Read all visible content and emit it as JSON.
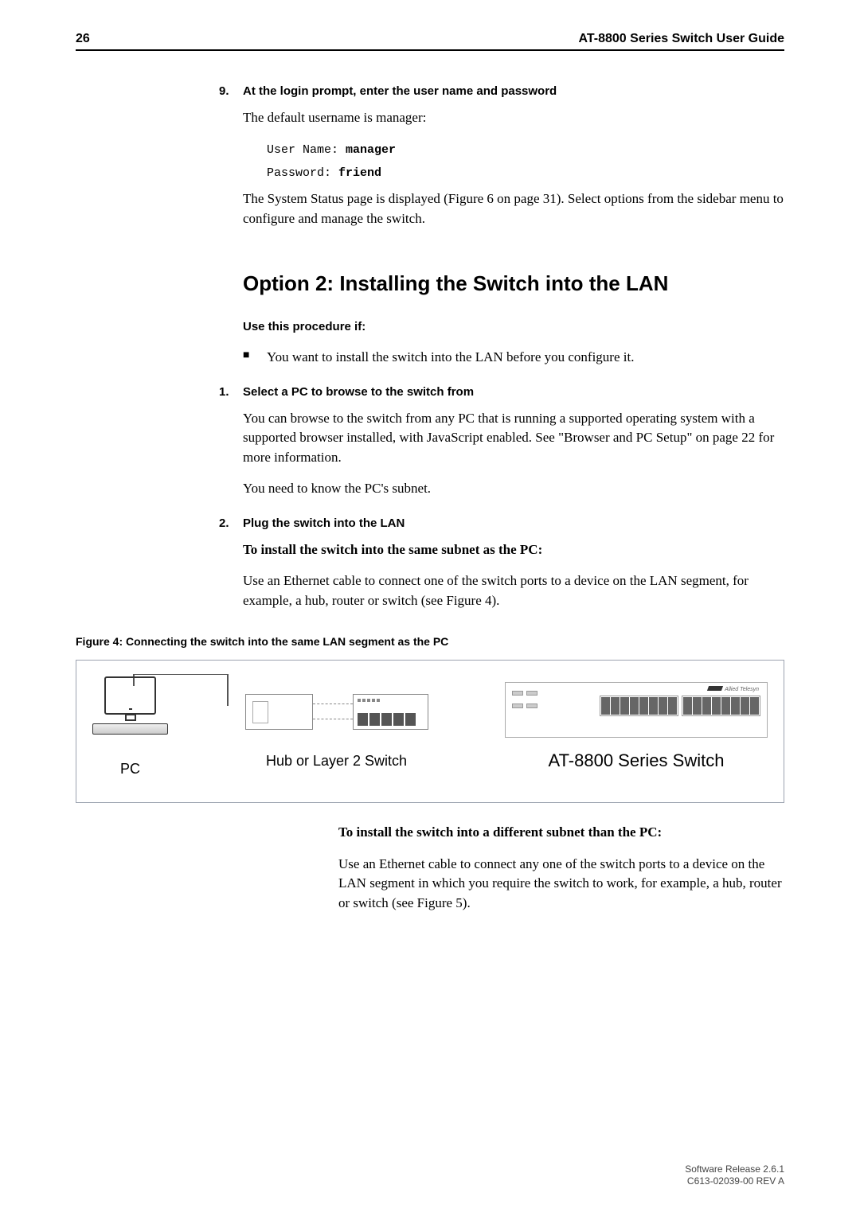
{
  "header": {
    "page_number": "26",
    "doc_title": "AT-8800 Series Switch User Guide"
  },
  "step9": {
    "num": "9.",
    "title": "At the login prompt, enter the user name and password",
    "intro": "The default username is manager:",
    "user_label": "User Name:",
    "user_value": "manager",
    "pass_label": "Password:",
    "pass_value": "friend",
    "after": "The System Status page is displayed (Figure 6 on page 31). Select options from the sidebar menu to configure and manage the switch."
  },
  "section": {
    "title": "Option 2: Installing the Switch into the LAN",
    "use_title": "Use this procedure if:",
    "bullet1": "You want to install the switch into the LAN before you configure it."
  },
  "step1": {
    "num": "1.",
    "title": "Select a PC to browse to the switch from",
    "p1": "You can browse to the switch from any PC that is running a supported operating system with a supported browser installed, with JavaScript enabled. See \"Browser and PC Setup\" on page 22 for more information.",
    "p2": "You need to know the PC's subnet."
  },
  "step2": {
    "num": "2.",
    "title": "Plug the switch into the LAN",
    "sub1": "To install the switch into the same subnet as the PC:",
    "p1": "Use an Ethernet cable to connect one of the switch ports to a device on the LAN segment, for example, a hub, router or switch (see Figure 4)."
  },
  "figure4": {
    "caption": "Figure 4: Connecting the switch into the same LAN segment as the PC",
    "pc_label": "PC",
    "hub_label": "Hub or Layer 2 Switch",
    "switch_label": "AT-8800 Series Switch",
    "logo_text": "Allied Telesyn"
  },
  "step2b": {
    "sub2": "To install the switch into a different subnet than the PC:",
    "p2": "Use an Ethernet cable to connect any one of the switch ports to a device on the LAN segment in which you require the switch to work, for example, a hub, router or switch (see Figure 5)."
  },
  "footer": {
    "line1": "Software Release 2.6.1",
    "line2": "C613-02039-00 REV A"
  }
}
